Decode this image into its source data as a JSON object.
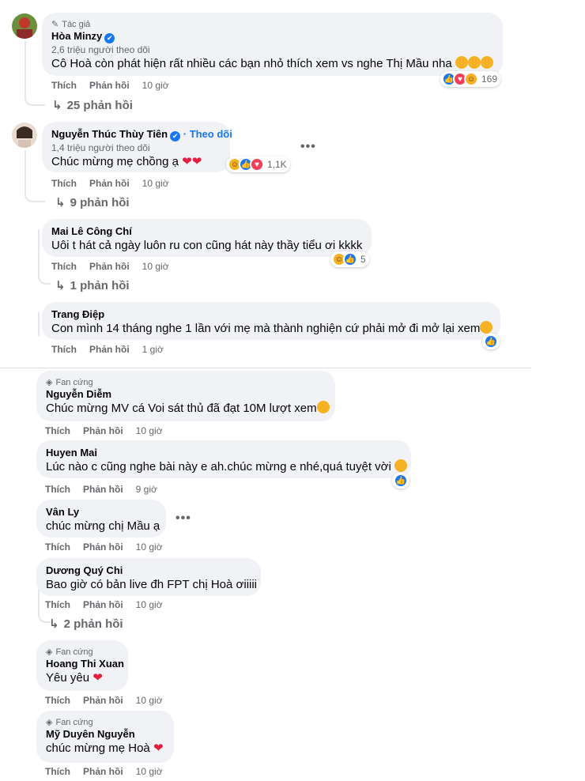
{
  "comments": [
    {
      "badge": "Tác giả",
      "name": "Hòa Minzy",
      "followers": "2,6 triệu người theo dõi",
      "text": "Cô Hoà còn phát hiện rất nhiều các bạn nhỏ thích xem vs nghe Thị Mầu nha",
      "like": "Thích",
      "reply": "Phản hồi",
      "time": "10 giờ",
      "react_count": "169",
      "replies": "25 phản hồi"
    },
    {
      "name": "Nguyễn Thúc Thùy Tiên",
      "follow": "Theo dõi",
      "followers": "1,4 triệu người theo dõi",
      "text": "Chúc mừng mẹ chồng ạ",
      "like": "Thích",
      "reply": "Phản hồi",
      "time": "10 giờ",
      "react_count": "1,1K",
      "replies": "9 phản hồi"
    },
    {
      "name": "Mai Lê Công Chí",
      "text": "Uôi t hát cả ngày luôn ru con cũng hát này thầy tiểu ơi kkkk",
      "like": "Thích",
      "reply": "Phản hồi",
      "time": "10 giờ",
      "react_count": "5",
      "replies": "1 phản hồi"
    },
    {
      "name": "Trang Điệp",
      "text": "Con mình 14 tháng nghe 1 lần với mẹ mà thành nghiện cứ phải mở đi mở lại xem",
      "like": "Thích",
      "reply": "Phản hồi",
      "time": "1 giờ"
    },
    {
      "badge": "Fan cứng",
      "name": "Nguyễn Diễm",
      "text": "Chúc mừng MV cá Voi sát thủ đã đạt 10M lượt xem",
      "like": "Thích",
      "reply": "Phản hồi",
      "time": "10 giờ"
    },
    {
      "name": "Huyen Mai",
      "text": "Lúc nào c cũng nghe bài này e ah.chúc mừng e nhé,quá tuyệt vời",
      "like": "Thích",
      "reply": "Phản hồi",
      "time": "9 giờ"
    },
    {
      "name": "Vân Ly",
      "text": "chúc mừng chị Mầu ạ",
      "like": "Thích",
      "reply": "Phản hồi",
      "time": "10 giờ"
    },
    {
      "name": "Dương Quý Chi",
      "text": "Bao giờ có bản live đh FPT chị Hoà ơiiiii",
      "like": "Thích",
      "reply": "Phản hồi",
      "time": "10 giờ",
      "replies": "2 phản hồi"
    },
    {
      "badge": "Fan cứng",
      "name": "Hoang Thi Xuan",
      "text": "Yêu yêu",
      "like": "Thích",
      "reply": "Phản hồi",
      "time": "10 giờ"
    },
    {
      "badge": "Fan cứng",
      "name": "Mỹ Duyên Nguyễn",
      "text": "chúc mừng mẹ Hoà",
      "like": "Thích",
      "reply": "Phản hồi",
      "time": "10 giờ"
    }
  ],
  "icons": {
    "verified": "✔",
    "reply_arrow": "↳",
    "more": "•••",
    "heart": "❤",
    "badge_icon": "◈"
  },
  "colors": {
    "accent": "#1877f2",
    "bubble": "#f0f2f5",
    "secondary_text": "#65676b",
    "heart": "#e41e3f"
  }
}
